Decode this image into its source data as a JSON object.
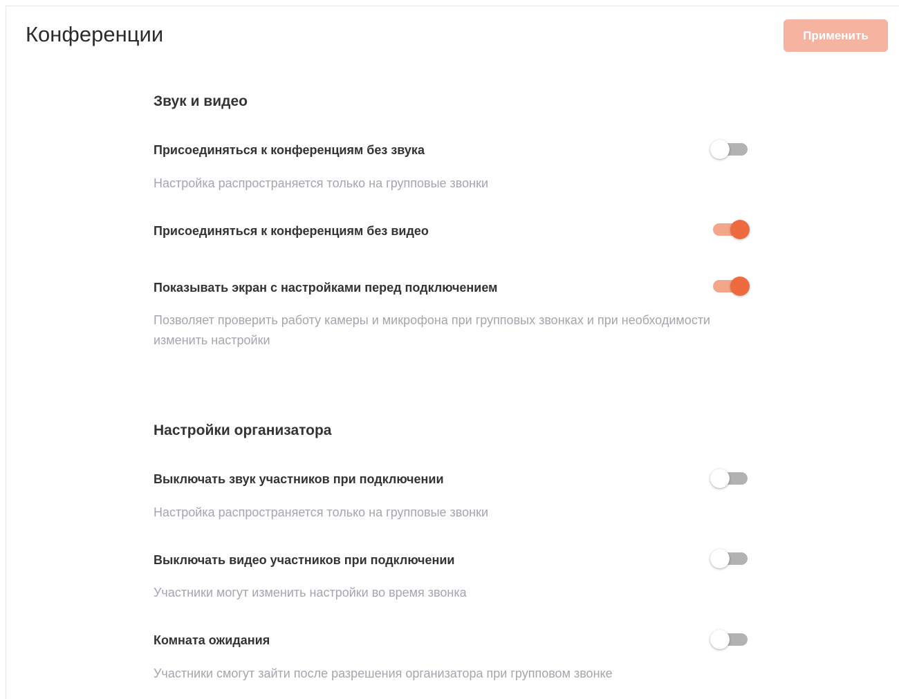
{
  "header": {
    "title": "Конференции",
    "apply_label": "Применить"
  },
  "sections": [
    {
      "title": "Звук и видео",
      "settings": [
        {
          "label": "Присоединяться к конференциям без звука",
          "description": "Настройка распространяется только на групповые звонки",
          "enabled": false
        },
        {
          "label": "Присоединяться к конференциям без видео",
          "description": "",
          "enabled": true
        },
        {
          "label": "Показывать экран с настройками перед подключением",
          "description": "Позволяет проверить работу камеры и микрофона при групповых звонках и при необходимости изменить настройки",
          "enabled": true
        }
      ]
    },
    {
      "title": "Настройки организатора",
      "settings": [
        {
          "label": "Выключать звук участников при подключении",
          "description": "Настройка распространяется только на групповые звонки",
          "enabled": false
        },
        {
          "label": "Выключать видео участников при подключении",
          "description": "Участники могут изменить настройки во время звонка",
          "enabled": false
        },
        {
          "label": "Комната ожидания",
          "description": "Участники смогут зайти после разрешения организатора при групповом звонке",
          "enabled": false
        }
      ]
    }
  ],
  "colors": {
    "accent": "#ee6a3f",
    "accent_track": "#f4a68a",
    "apply_button": "#f5b3a0",
    "toggle_off_track": "#b2b2b2",
    "description_text": "#a3a6ad"
  }
}
